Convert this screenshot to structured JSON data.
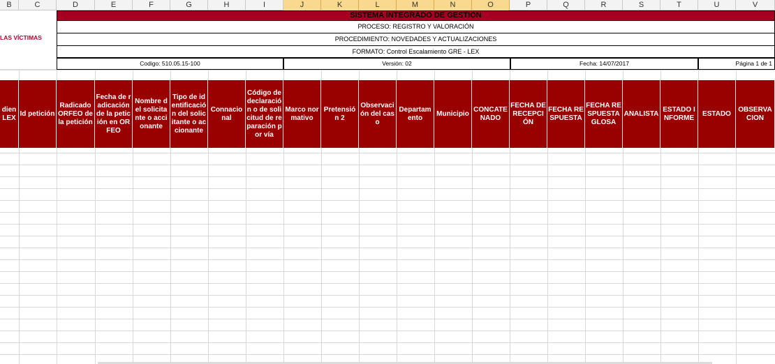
{
  "columns": [
    "B",
    "C",
    "D",
    "E",
    "F",
    "G",
    "H",
    "I",
    "J",
    "K",
    "L",
    "M",
    "N",
    "O",
    "P",
    "Q",
    "R",
    "S",
    "T",
    "U",
    "V"
  ],
  "selected_columns": [
    "J",
    "K",
    "L",
    "M",
    "N",
    "O"
  ],
  "logo_text": "LAS VÍCTIMAS",
  "header": {
    "title": "SISTEMA INTEGRADO DE GESTION",
    "proceso": "PROCESO: REGISTRO Y VALORACIÓN",
    "procedimiento": "PROCEDIMIENTO: NOVEDADES Y ACTUALIZACIONES",
    "formato": "FORMATO: Control Escalamiento GRE  - LEX",
    "codigo": "Codigo: 510.05.15-100",
    "version": "Versión: 02",
    "fecha": "Fecha: 14/07/2017",
    "pagina": "Página 1 de 1"
  },
  "table_headers": [
    "dien LEX",
    "Id petición",
    "Radicado ORFEO de la petición",
    "Fecha de radicación de la petición en ORFEO",
    "Nombre del solicitante o accionante",
    "Tipo de identificación del solicitante o accionante",
    "Connacional",
    "Código de declaración o de solicitud de reparación por vía",
    "Marco normativo",
    "Pretensión 2",
    "Observación del caso",
    "Departamento",
    "Municipio",
    "CONCATENADO",
    "FECHA DE RECEPCIÓN",
    "FECHA RESPUESTA",
    "FECHA RESPUESTA GLOSA",
    "ANALISTA",
    "ESTADO INFORME",
    "ESTADO",
    "OBSERVACION"
  ],
  "colors": {
    "header_red": "#990000",
    "title_red": "#a50021",
    "selection": "#f9d98f"
  }
}
